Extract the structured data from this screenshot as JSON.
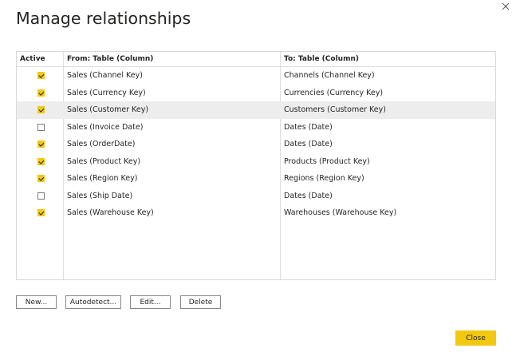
{
  "dialog": {
    "title": "Manage relationships",
    "close_icon": "close-icon"
  },
  "table": {
    "headers": {
      "active": "Active",
      "from": "From: Table (Column)",
      "to": "To: Table (Column)"
    },
    "rows": [
      {
        "active": true,
        "from": "Sales (Channel Key)",
        "to": "Channels (Channel Key)",
        "selected": false
      },
      {
        "active": true,
        "from": "Sales (Currency Key)",
        "to": "Currencies (Currency Key)",
        "selected": false
      },
      {
        "active": true,
        "from": "Sales (Customer Key)",
        "to": "Customers (Customer Key)",
        "selected": true
      },
      {
        "active": false,
        "from": "Sales (Invoice Date)",
        "to": "Dates (Date)",
        "selected": false
      },
      {
        "active": true,
        "from": "Sales (OrderDate)",
        "to": "Dates (Date)",
        "selected": false
      },
      {
        "active": true,
        "from": "Sales (Product Key)",
        "to": "Products (Product Key)",
        "selected": false
      },
      {
        "active": true,
        "from": "Sales (Region Key)",
        "to": "Regions (Region Key)",
        "selected": false
      },
      {
        "active": false,
        "from": "Sales (Ship Date)",
        "to": "Dates (Date)",
        "selected": false
      },
      {
        "active": true,
        "from": "Sales (Warehouse Key)",
        "to": "Warehouses (Warehouse Key)",
        "selected": false
      }
    ]
  },
  "buttons": {
    "new": "New...",
    "autodetect": "Autodetect...",
    "edit": "Edit...",
    "delete": "Delete",
    "close": "Close"
  },
  "colors": {
    "accent": "#f2c811",
    "selected_row": "#ededed",
    "grid_border": "#d8d8d8"
  }
}
